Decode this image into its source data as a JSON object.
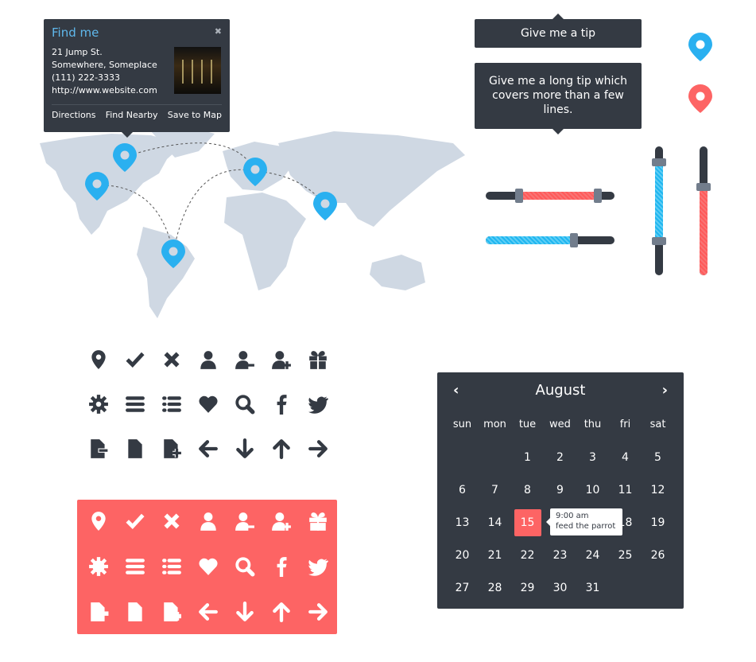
{
  "popup": {
    "title": "Find me",
    "address": [
      "21 Jump St.",
      "Somewhere, Someplace",
      "(111) 222-3333",
      "http://www.website.com"
    ],
    "actions": [
      "Directions",
      "Find Nearby",
      "Save to Map"
    ]
  },
  "tooltips": {
    "short": "Give me a tip",
    "long": "Give me a long tip which covers more than a few lines."
  },
  "colors": {
    "dark": "#343a43",
    "blue": "#2ab0f0",
    "red": "#fd6464",
    "map": "#cfd8e3",
    "thumb": "#727d8c"
  },
  "sliders": [
    {
      "orientation": "horizontal",
      "color": "red",
      "range": [
        26,
        87
      ]
    },
    {
      "orientation": "horizontal",
      "color": "blue",
      "value": 69
    },
    {
      "orientation": "vertical",
      "color": "blue",
      "range": [
        26,
        88
      ]
    },
    {
      "orientation": "vertical",
      "color": "red",
      "value": 69
    }
  ],
  "icons": [
    "map-pin",
    "check",
    "close",
    "user",
    "user-remove",
    "user-add",
    "gift",
    "gear",
    "menu",
    "list",
    "heart",
    "search",
    "facebook",
    "twitter",
    "document-remove",
    "document",
    "document-add",
    "arrow-left",
    "arrow-down",
    "arrow-up",
    "arrow-right"
  ],
  "calendar": {
    "month": "August",
    "prev": "‹",
    "next": "›",
    "weekdays": [
      "sun",
      "mon",
      "tue",
      "wed",
      "thu",
      "fri",
      "sat"
    ],
    "weeks": [
      [
        "",
        "",
        "1",
        "2",
        "3",
        "4",
        "5"
      ],
      [
        "6",
        "7",
        "8",
        "9",
        "10",
        "11",
        "12"
      ],
      [
        "13",
        "14",
        "15",
        "16",
        "17",
        "18",
        "19"
      ],
      [
        "20",
        "21",
        "22",
        "23",
        "24",
        "25",
        "26"
      ],
      [
        "27",
        "28",
        "29",
        "30",
        "31",
        "",
        ""
      ]
    ],
    "selected": "15",
    "event": {
      "time": "9:00 am",
      "title": "feed the parrot"
    }
  }
}
